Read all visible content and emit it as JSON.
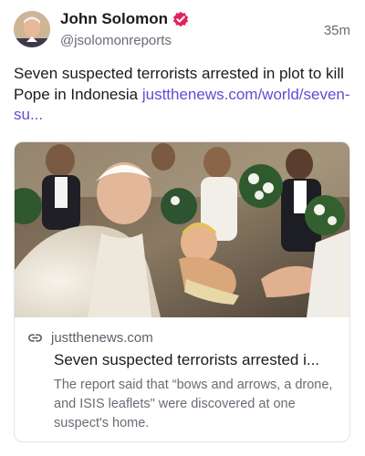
{
  "author": {
    "display_name": "John Solomon",
    "handle": "@jsolomonreports",
    "verified": true,
    "avatar_icon": "avatar-photo"
  },
  "post": {
    "timestamp": "35m",
    "text": "Seven suspected terrorists arrested in plot to kill Pope in Indonesia ",
    "link_text": "justthenews.com/world/seven-su..."
  },
  "link_card": {
    "domain": "justthenews.com",
    "title": "Seven suspected terrorists arrested i...",
    "description": "The report said that “bows and arrows, a drone, and ISIS leaflets\" were discovered at one suspect's home.",
    "link_icon": "link-icon"
  },
  "colors": {
    "link": "#5b4fd6",
    "verified_badge": "#e0245e",
    "secondary_text": "#6b6b76",
    "card_border": "#e3e3e8"
  }
}
